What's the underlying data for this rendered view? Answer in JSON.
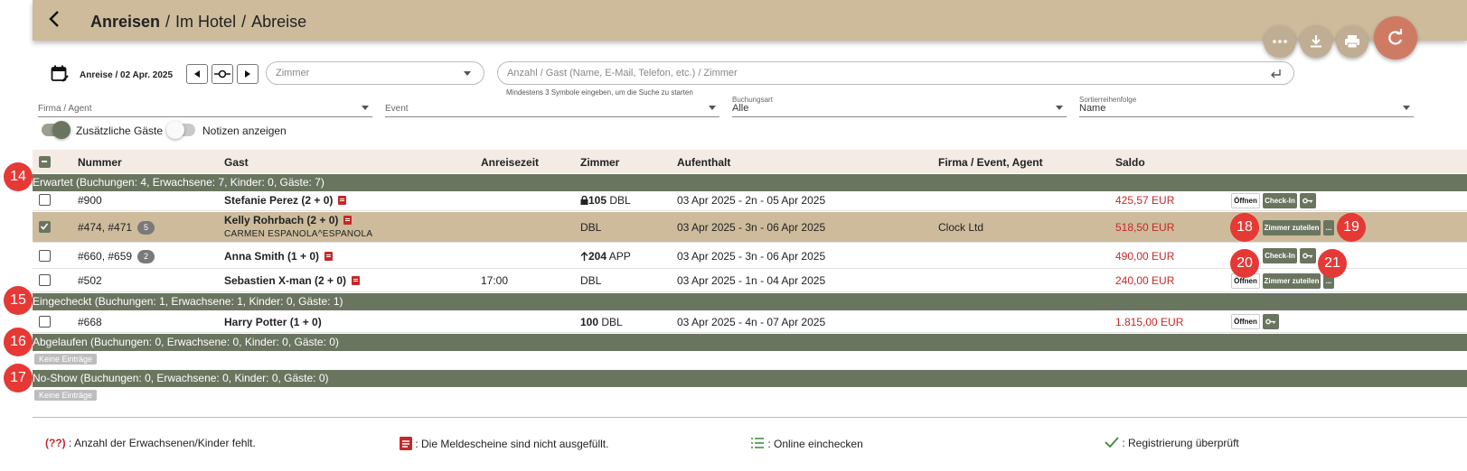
{
  "header": {
    "crumb_active": "Anreisen",
    "crumb_2": "Im Hotel",
    "crumb_3": "Abreise",
    "separator": "/"
  },
  "filters": {
    "date_label": "Anreise / 02 Apr. 2025",
    "room_placeholder": "Zimmer",
    "search_placeholder": "Anzahl / Gast (Name, E-Mail, Telefon, etc.) / Zimmer",
    "search_hint": "Mindestens 3 Symbole eingeben, um die Suche zu starten",
    "company_placeholder": "Firma / Agent",
    "event_placeholder": "Event",
    "booking_type_label": "Buchungsart",
    "booking_type_value": "Alle",
    "sort_label": "Sortierreihenfolge",
    "sort_value": "Name",
    "toggle_extra_guests": "Zusätzliche Gäste",
    "toggle_notes": "Notizen anzeigen",
    "toggle_extra_guests_on": true,
    "toggle_notes_on": false
  },
  "table": {
    "headers": [
      "Nummer",
      "Gast",
      "Anreisezeit",
      "Zimmer",
      "Aufenthalt",
      "Firma / Event, Agent",
      "Saldo"
    ]
  },
  "groups": {
    "expected": "Erwartet (Buchungen: 4, Erwachsene: 7, Kinder: 0, Gäste: 7)",
    "checked_in": "Eingecheckt (Buchungen: 1, Erwachsene: 1, Kinder: 0, Gäste: 1)",
    "expired": "Abgelaufen (Buchungen: 0, Erwachsene: 0, Kinder: 0, Gäste: 0)",
    "no_show": "No-Show (Buchungen: 0, Erwachsene: 0, Kinder: 0, Gäste: 0)",
    "empty_label": "Keine Einträge"
  },
  "rows": [
    {
      "number": "#900",
      "guest": "Stefanie Perez (2 + 0)",
      "sub": "",
      "arrival": "",
      "room_num": "105",
      "room_type": "DBL",
      "stay": "03 Apr 2025 - 2n - 05 Apr 2025",
      "company": "",
      "balance": "425,57 EUR",
      "count": ""
    },
    {
      "number": "#474, #471",
      "guest": "Kelly Rohrbach (2 + 0)",
      "sub": "CARMEN ESPANOLA^ESPANOLA",
      "arrival": "",
      "room_num": "",
      "room_type": "DBL",
      "stay": "03 Apr 2025 - 3n - 06 Apr 2025",
      "company": "Clock Ltd",
      "balance": "518,50 EUR",
      "count": "5"
    },
    {
      "number": "#660, #659",
      "guest": "Anna Smith (1 + 0)",
      "sub": "",
      "arrival": "",
      "room_num": "204",
      "room_type": "APP",
      "stay": "03 Apr 2025 - 3n - 06 Apr 2025",
      "company": "",
      "balance": "490,00 EUR",
      "count": "2"
    },
    {
      "number": "#502",
      "guest": "Sebastien X-man (2 + 0)",
      "sub": "",
      "arrival": "17:00",
      "room_num": "",
      "room_type": "DBL",
      "stay": "03 Apr 2025 - 1n - 04 Apr 2025",
      "company": "",
      "balance": "240,00 EUR",
      "count": ""
    },
    {
      "number": "#668",
      "guest": "Harry Potter (1 + 0)",
      "sub": "",
      "arrival": "",
      "room_num": "100",
      "room_type": "DBL",
      "stay": "03 Apr 2025 - 4n - 07 Apr 2025",
      "company": "",
      "balance": "1.815,00 EUR",
      "count": ""
    }
  ],
  "actions": {
    "open": "Öffnen",
    "checkin": "Check-In",
    "assign_room": "Zimmer zuteilen",
    "more": "..."
  },
  "markers": [
    "14",
    "15",
    "16",
    "17",
    "18",
    "19",
    "20",
    "21"
  ],
  "legend": {
    "missing_count_code": "(??)",
    "missing_count_text": ": Anzahl der Erwachsenen/Kinder fehlt.",
    "forms_text": ": Die Meldescheine sind nicht ausgefüllt.",
    "online_text": ": Online einchecken",
    "verified_text": ": Registrierung überprüft"
  },
  "colors": {
    "header_bg": "#cdbb9c",
    "group_bg": "#6a7560",
    "accent_red": "#c62828",
    "marker_red": "#e53935",
    "fab_refresh": "#cf7b63"
  }
}
